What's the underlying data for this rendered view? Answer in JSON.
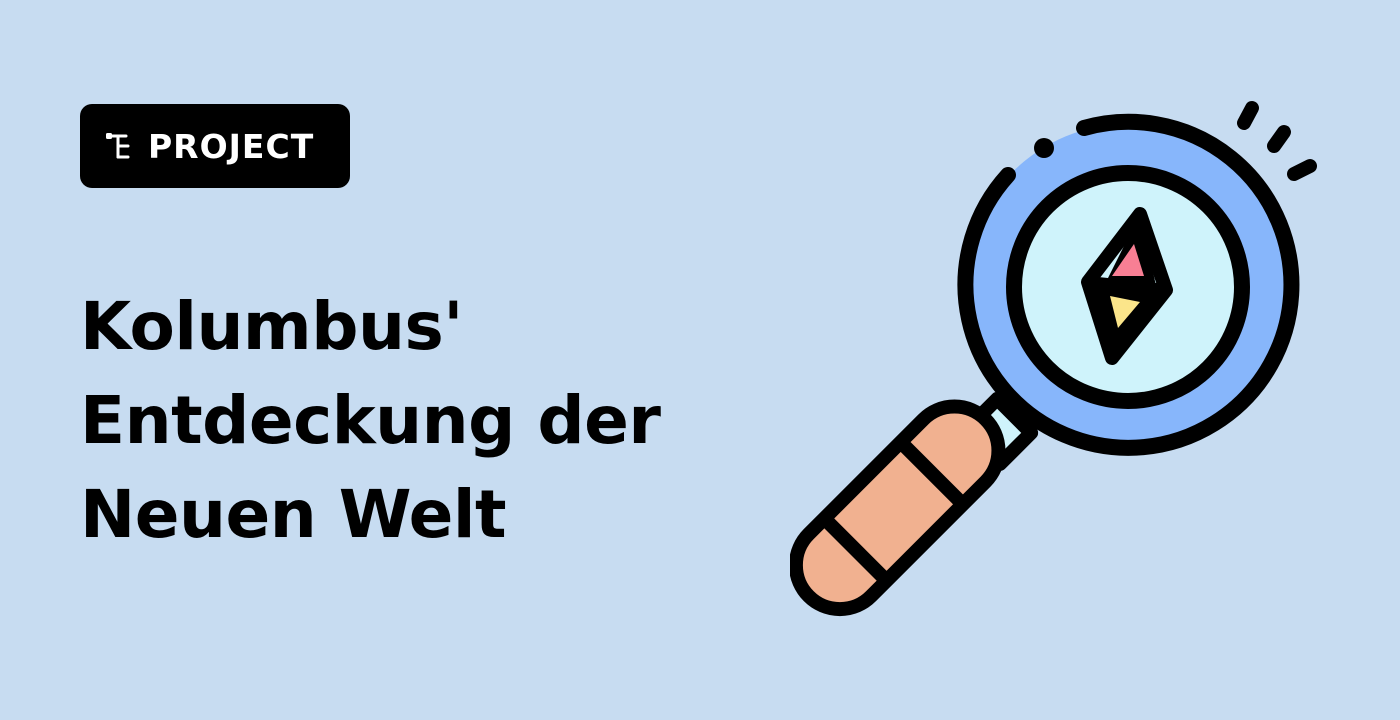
{
  "badge": {
    "icon": "project-tree-icon",
    "label": "PROJECT"
  },
  "title": {
    "lines": [
      "Kolumbus'",
      "Entdeckung der",
      "Neuen Welt"
    ]
  },
  "illustration": {
    "icon": "magnifying-glass-compass-icon"
  },
  "colors": {
    "background": "#c7dcf1",
    "badge": "#000000",
    "badge_text": "#ffffff",
    "lens_ring": "#87b6fb",
    "lens_glass": "#cff3fb",
    "handle": "#f1b190",
    "compass_north": "#f87f94",
    "compass_south": "#fbe58a",
    "outline": "#000000"
  }
}
